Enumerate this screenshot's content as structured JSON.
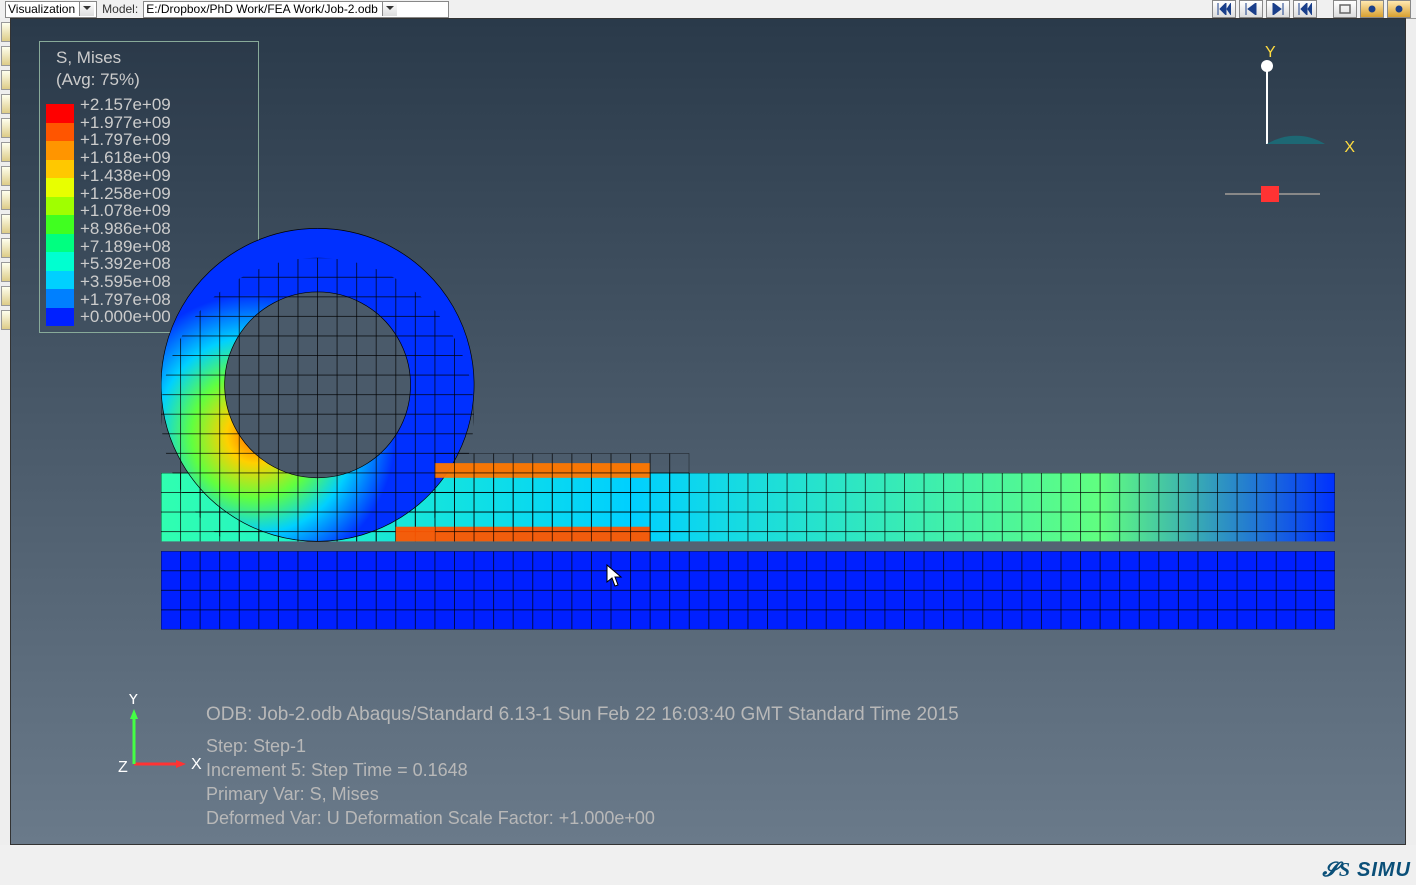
{
  "toolbar": {
    "module_label": "Visualization",
    "model_label": "Model:",
    "model_path": "E:/Dropbox/PhD Work/FEA Work/Job-2.odb"
  },
  "legend": {
    "title": "S, Mises",
    "avg": "(Avg: 75%)",
    "values": [
      "+2.157e+09",
      "+1.977e+09",
      "+1.797e+09",
      "+1.618e+09",
      "+1.438e+09",
      "+1.258e+09",
      "+1.078e+09",
      "+8.986e+08",
      "+7.189e+08",
      "+5.392e+08",
      "+3.595e+08",
      "+1.797e+08",
      "+0.000e+00"
    ],
    "colors": [
      "#ff0000",
      "#ff5500",
      "#ff9500",
      "#ffc800",
      "#e8ff00",
      "#a0ff00",
      "#40ff20",
      "#00ff80",
      "#00ffd0",
      "#00d0ff",
      "#0080ff",
      "#0020ff"
    ]
  },
  "triad": {
    "y": "Y",
    "x": "X"
  },
  "status": {
    "odb_line": "ODB: Job-2.odb     Abaqus/Standard 6.13-1     Sun Feb 22 16:03:40 GMT Standard Time 2015",
    "step": "Step: Step-1",
    "increment": "Increment      5: Step Time =   0.1648",
    "primary_var": "Primary Var: S, Mises",
    "deformed_var": "Deformed Var: U   Deformation Scale Factor: +1.000e+00"
  },
  "mini_axes": {
    "x": "X",
    "y": "Y",
    "z": "Z"
  },
  "brand": "SIMU"
}
